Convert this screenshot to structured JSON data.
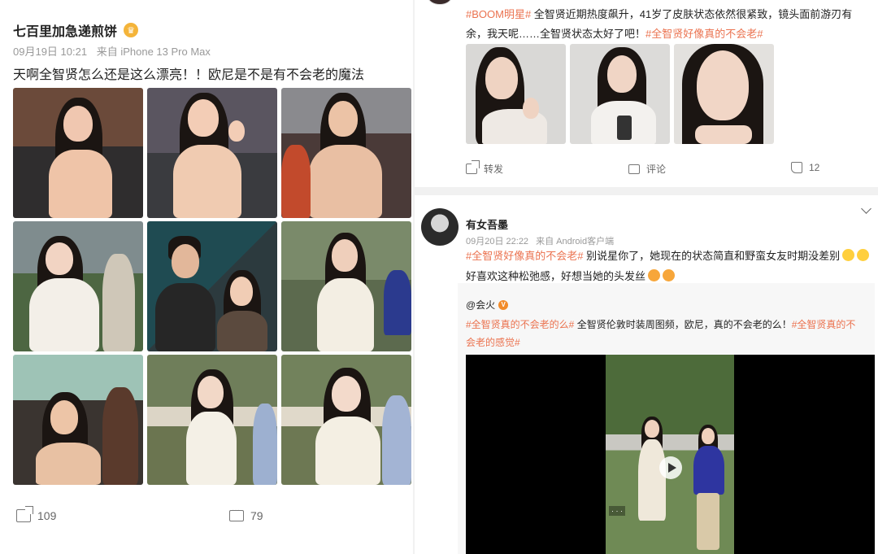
{
  "left_post": {
    "username": "七百里加急递煎饼",
    "date": "09月19日 10:21",
    "source": "来自 iPhone 13 Pro Max",
    "text": "天啊全智贤怎么还是这么漂亮！！欧尼是不是有不会老的魔法",
    "share_count": "109",
    "comment_count": "79"
  },
  "right_top_post": {
    "tag_1": "#BOOM明星#",
    "text_1": " 全智贤近期热度飙升，41岁了皮肤状态依然很紧致，镜头面前游刃有余，我天呢……全智贤状态太好了吧！",
    "tag_2": "#全智贤好像真的不会老#",
    "share_label": "转发",
    "comment_label": "评论",
    "like_count": "12"
  },
  "right_bottom_post": {
    "username": "有女吾墨",
    "date": "09月20日 22:22",
    "source": "来自 Android客户端",
    "tag": "#全智贤好像真的不会老#",
    "text_1": " 别说星你了，她现在的状态简直和野蛮女友时期没差别",
    "text_2": "好喜欢这种松弛感，好想当她的头发丝",
    "repost": {
      "username": "@会火",
      "tag_1": "#全智贤真的不会老的么#",
      "text": " 全智贤伦敦时装周图频，欧尼，真的不会老的么！",
      "tag_2": "#全智贤真的不会老的感觉#"
    }
  },
  "colors": {
    "accent": "#eb7350",
    "text": "#222222",
    "meta": "#999999"
  }
}
